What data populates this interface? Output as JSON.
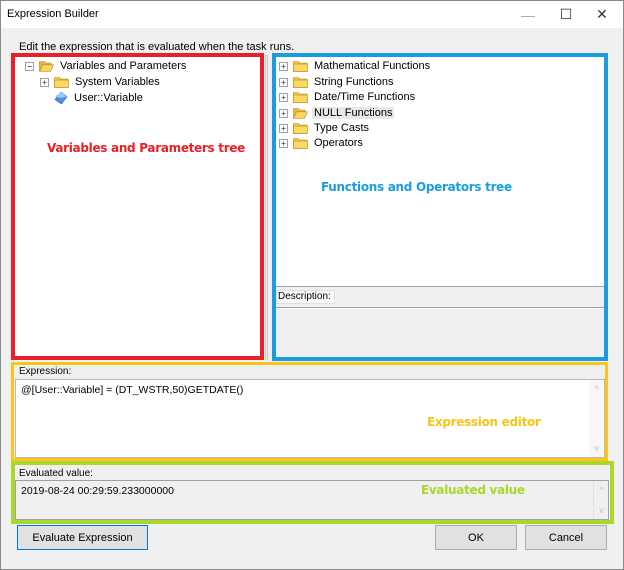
{
  "window": {
    "title": "Expression Builder",
    "controls": {
      "minimize": "—",
      "maximize": "☐",
      "close": "✕"
    }
  },
  "instruction": "Edit the expression that is evaluated when the task runs.",
  "variables_tree": {
    "items": [
      {
        "label": "Variables and Parameters",
        "icon": "folder-open-icon",
        "toggle": "−",
        "level": 0
      },
      {
        "label": "System Variables",
        "icon": "folder-icon",
        "toggle": "+",
        "level": 1
      },
      {
        "label": "User::Variable",
        "icon": "variable-icon",
        "toggle": "",
        "level": 1
      }
    ]
  },
  "functions_tree": {
    "items": [
      {
        "label": "Mathematical Functions",
        "icon": "folder-icon",
        "toggle": "+"
      },
      {
        "label": "String Functions",
        "icon": "folder-icon",
        "toggle": "+"
      },
      {
        "label": "Date/Time Functions",
        "icon": "folder-icon",
        "toggle": "+"
      },
      {
        "label": "NULL Functions",
        "icon": "folder-open-icon",
        "toggle": "+",
        "highlighted": true
      },
      {
        "label": "Type Casts",
        "icon": "folder-icon",
        "toggle": "+"
      },
      {
        "label": "Operators",
        "icon": "folder-icon",
        "toggle": "+"
      }
    ]
  },
  "description": {
    "label": "Description:"
  },
  "expression": {
    "label": "Expression:",
    "value": "@[User::Variable] = (DT_WSTR,50)GETDATE()"
  },
  "evaluated": {
    "label": "Evaluated value:",
    "value": "2019-08-24 00:29:59.233000000"
  },
  "annotations": {
    "variables_tree": "Variables and Parameters tree",
    "functions_tree": "Functions and Operators tree",
    "expression_editor": "Expression editor",
    "evaluated_value": "Evaluated value"
  },
  "annotation_colors": {
    "variables_tree": "#e8202a",
    "functions_tree": "#1a9de0",
    "expression_editor": "#fbc51a",
    "evaluated_value": "#a6d92b"
  },
  "buttons": {
    "evaluate": "Evaluate Expression",
    "ok": "OK",
    "cancel": "Cancel"
  },
  "scroll_arrows": {
    "up": "^",
    "down": "v"
  }
}
